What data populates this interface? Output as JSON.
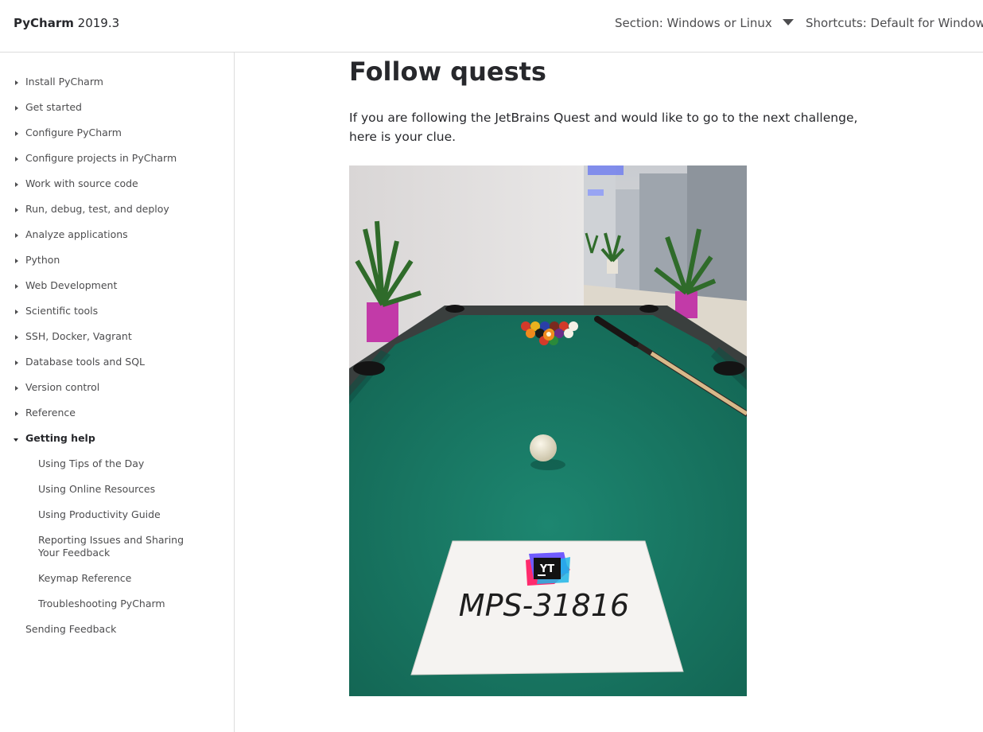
{
  "header": {
    "product_name": "PyCharm",
    "version": "2019.3",
    "section_label": "Section: Windows or Linux",
    "shortcuts_label": "Shortcuts: Default for Windows"
  },
  "sidebar": {
    "items": [
      {
        "label": "Install PyCharm"
      },
      {
        "label": "Get started"
      },
      {
        "label": "Configure PyCharm"
      },
      {
        "label": "Configure projects in PyCharm"
      },
      {
        "label": "Work with source code"
      },
      {
        "label": "Run, debug, test, and deploy"
      },
      {
        "label": "Analyze applications"
      },
      {
        "label": "Python"
      },
      {
        "label": "Web Development"
      },
      {
        "label": "Scientific tools"
      },
      {
        "label": "SSH, Docker, Vagrant"
      },
      {
        "label": "Database tools and SQL"
      },
      {
        "label": "Version control"
      },
      {
        "label": "Reference"
      },
      {
        "label": "Getting help"
      }
    ],
    "children": [
      {
        "label": "Using Tips of the Day"
      },
      {
        "label": "Using Online Resources"
      },
      {
        "label": "Using Productivity Guide"
      },
      {
        "label": "Reporting Issues and Sharing Your Feedback"
      },
      {
        "label": "Keymap Reference"
      },
      {
        "label": "Troubleshooting PyCharm"
      }
    ],
    "footer_item": {
      "label": "Sending Feedback"
    }
  },
  "main": {
    "title": "Follow quests",
    "intro": "If you are following the JetBrains Quest and would like to go to the next challenge, here is your clue.",
    "photo": {
      "logo_text": "YT",
      "clue_code": "MPS-31816"
    }
  },
  "colors": {
    "felt": "#1a7a66",
    "rail": "#3a3f3e",
    "text": "#27282c",
    "muted": "#4d4d4f",
    "divider": "#dcdcdc"
  }
}
